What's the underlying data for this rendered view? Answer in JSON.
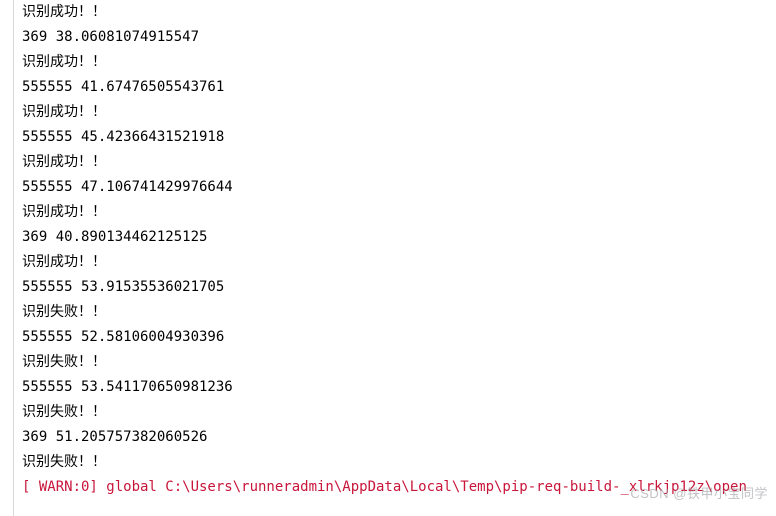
{
  "console": {
    "lines": [
      {
        "text": "识别成功！！",
        "type": "normal"
      },
      {
        "text": "369 38.06081074915547",
        "type": "normal"
      },
      {
        "text": "识别成功！！",
        "type": "normal"
      },
      {
        "text": "555555 41.67476505543761",
        "type": "normal"
      },
      {
        "text": "识别成功！！",
        "type": "normal"
      },
      {
        "text": "555555 45.42366431521918",
        "type": "normal"
      },
      {
        "text": "识别成功！！",
        "type": "normal"
      },
      {
        "text": "555555 47.106741429976644",
        "type": "normal"
      },
      {
        "text": "识别成功！！",
        "type": "normal"
      },
      {
        "text": "369 40.890134462125125",
        "type": "normal"
      },
      {
        "text": "识别成功！！",
        "type": "normal"
      },
      {
        "text": "555555 53.91535536021705",
        "type": "normal"
      },
      {
        "text": "识别失败！！",
        "type": "normal"
      },
      {
        "text": "555555 52.58106004930396",
        "type": "normal"
      },
      {
        "text": "识别失败！！",
        "type": "normal"
      },
      {
        "text": "555555 53.541170650981236",
        "type": "normal"
      },
      {
        "text": "识别失败！！",
        "type": "normal"
      },
      {
        "text": "369 51.205757382060526",
        "type": "normal"
      },
      {
        "text": "识别失败！！",
        "type": "normal"
      },
      {
        "text": "[ WARN:0] global C:\\Users\\runneradmin\\AppData\\Local\\Temp\\pip-req-build-_xlrkjp12z\\open",
        "type": "warn"
      }
    ]
  },
  "watermark": "CSDN @铁甲小宝同学"
}
